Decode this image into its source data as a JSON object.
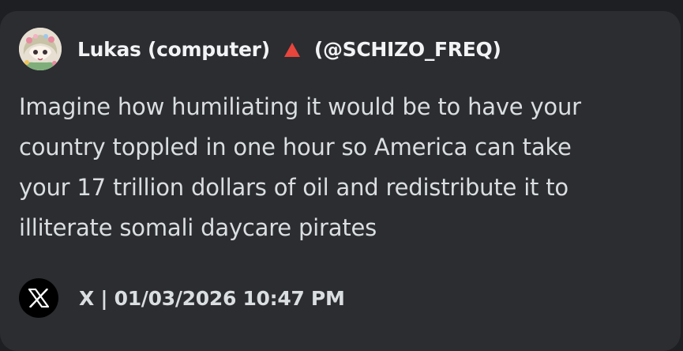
{
  "embed": {
    "author": {
      "name": "Lukas (computer)",
      "badge_icon": "red-triangle-icon",
      "badge_color": "#e8453c",
      "handle": "(@SCHIZO_FREQ)"
    },
    "post": {
      "lines": [
        "Imagine how humiliating it would be to have your",
        "country toppled in one hour so America can take",
        "your 17 trillion dollars of oil and redistribute it to",
        "illiterate somali daycare pirates"
      ]
    },
    "footer": {
      "source_icon": "x-logo-icon",
      "text": "X | 01/03/2026 10:47 PM"
    }
  },
  "colors": {
    "page_background": "#1e1f23",
    "card_background": "#2b2d31",
    "primary_text": "#f2f3f5",
    "body_text": "#dbdee1"
  }
}
